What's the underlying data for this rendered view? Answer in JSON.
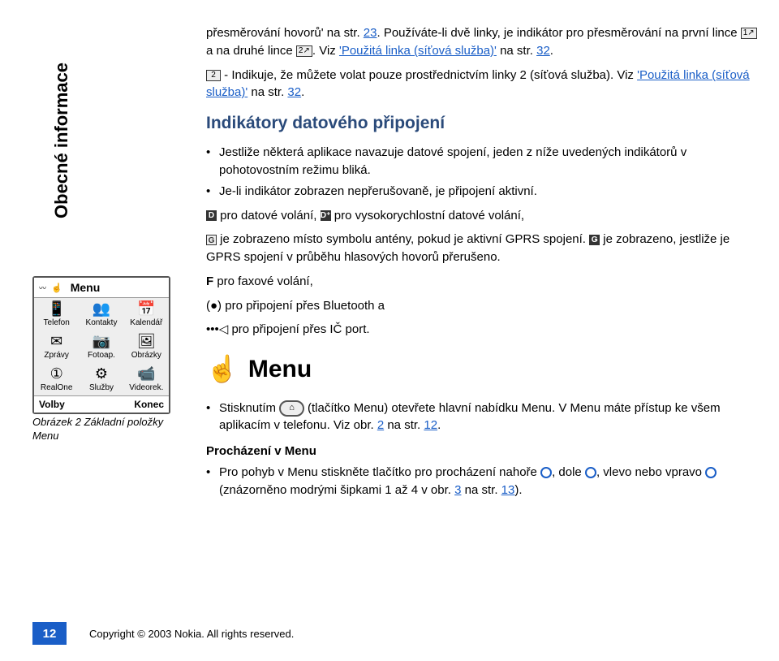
{
  "sidebar_title": "Obecné informace",
  "phone": {
    "menu_label": "Menu",
    "items": [
      {
        "icon": "📱",
        "label": "Telefon"
      },
      {
        "icon": "👥",
        "label": "Kontakty"
      },
      {
        "icon": "📅",
        "label": "Kalendář"
      },
      {
        "icon": "✉",
        "label": "Zprávy"
      },
      {
        "icon": "📷",
        "label": "Fotoap."
      },
      {
        "icon": "🖼",
        "label": "Obrázky"
      },
      {
        "icon": "①",
        "label": "RealOne"
      },
      {
        "icon": "⚙",
        "label": "Služby"
      },
      {
        "icon": "📹",
        "label": "Videorek."
      }
    ],
    "left_soft": "Volby",
    "right_soft": "Konec"
  },
  "fig_caption": "Obrázek 2 Základní položky Menu",
  "content": {
    "p1_a": "přesměrování hovorů' na str. ",
    "p1_link1": "23",
    "p1_b": ". Používáte-li dvě linky, je indikátor pro přesměrování na první lince ",
    "p1_c": " a na druhé lince ",
    "p1_d": ". Viz ",
    "link_pouzita": "'Použitá linka (síťová služba)'",
    "p1_e": " na str. ",
    "p1_link2": "32",
    "p1_f": ".",
    "p2_a": " - Indikuje, že můžete volat pouze prostřednictvím linky 2 (síťová služba). Viz ",
    "p2_b": " na str. ",
    "p2_link": "32",
    "p2_c": ".",
    "h_indikatory": "Indikátory datového připojení",
    "li1": "Jestliže některá aplikace navazuje datové spojení, jeden z níže uvedených indikátorů v pohotovostním režimu bliká.",
    "li2": "Je-li indikátor zobrazen nepřerušovaně, je připojení aktivní.",
    "p3_a": " pro datové volání, ",
    "p3_b": " pro vysokorychlostní datové volání,",
    "p4_a": " je zobrazeno místo symbolu antény, pokud je aktivní GPRS spojení. ",
    "p4_b": " je zobrazeno, jestliže je GPRS spojení v průběhu hlasových hovorů přerušeno.",
    "p5": " pro faxové volání,",
    "p6": " pro připojení přes Bluetooth a",
    "p7": " pro připojení přes IČ port.",
    "h_menu": "Menu",
    "menuli_a": "Stisknutím ",
    "menuli_b": " (tlačítko Menu) otevřete hlavní nabídku Menu. V Menu máte přístup ke všem aplikacím v telefonu. Viz obr. ",
    "menuli_link1": "2",
    "menuli_c": " na str. ",
    "menuli_link2": "12",
    "menuli_d": ".",
    "h_prochazeni": "Procházení v Menu",
    "navli_a": "Pro pohyb v Menu stiskněte tlačítko pro procházení nahoře ",
    "navli_b": ", dole ",
    "navli_c": ", vlevo nebo vpravo ",
    "navli_d": " (znázorněno modrými šipkami 1 až 4 v obr. ",
    "navli_link1": "3",
    "navli_e": " na str. ",
    "navli_link2": "13",
    "navli_f": ")."
  },
  "footer": {
    "page": "12",
    "copyright": "Copyright © 2003 Nokia. All rights reserved."
  }
}
